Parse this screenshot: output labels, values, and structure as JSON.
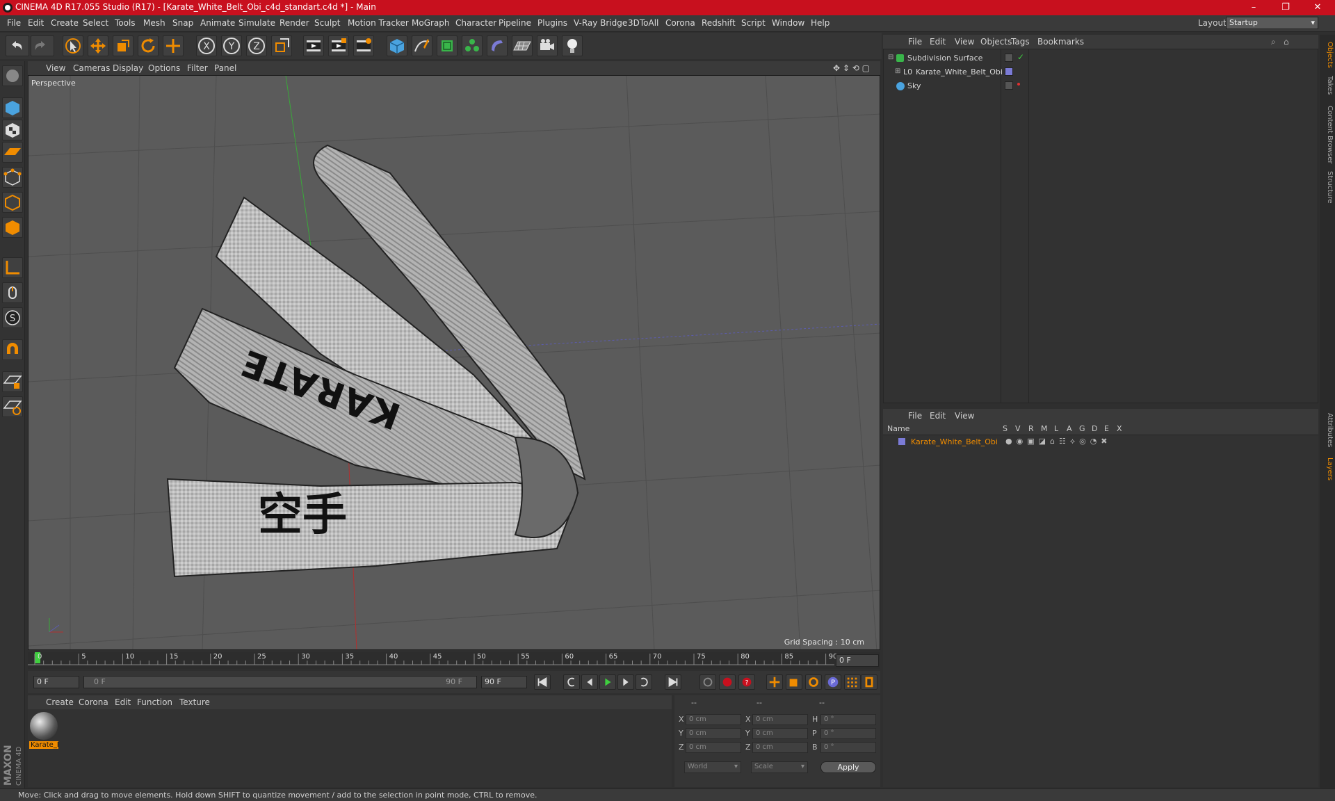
{
  "window": {
    "title": "CINEMA 4D R17.055 Studio (R17) - [Karate_White_Belt_Obi_c4d_standart.c4d *] - Main",
    "minimize": "–",
    "restore": "❐",
    "close": "✕"
  },
  "menu": [
    "File",
    "Edit",
    "Create",
    "Select",
    "Tools",
    "Mesh",
    "Snap",
    "Animate",
    "Simulate",
    "Render",
    "Sculpt",
    "Motion Tracker",
    "MoGraph",
    "Character",
    "Pipeline",
    "Plugins",
    "V-Ray Bridge",
    "3DToAll",
    "Corona",
    "Redshift",
    "Script",
    "Window",
    "Help"
  ],
  "layout": {
    "label": "Layout:",
    "value": "Startup"
  },
  "viewport": {
    "menu": [
      "View",
      "Cameras",
      "Display",
      "Options",
      "Filter",
      "Panel"
    ],
    "label": "Perspective",
    "grid_spacing": "Grid Spacing : 10 cm",
    "belt_text_1": "KARATE",
    "belt_text_2": "空手"
  },
  "timeline": {
    "ticks": [
      "0",
      "5",
      "10",
      "15",
      "20",
      "25",
      "30",
      "35",
      "40",
      "45",
      "50",
      "55",
      "60",
      "65",
      "70",
      "75",
      "80",
      "85",
      "90"
    ],
    "current_frame": "0 F",
    "start_field": "0 F",
    "range_start": "0 F",
    "range_end": "90 F",
    "end_field": "90 F"
  },
  "material_manager": {
    "menu": [
      "Create",
      "Corona",
      "Edit",
      "Function",
      "Texture"
    ],
    "materials": [
      {
        "label": "Karate_B"
      }
    ]
  },
  "coordinates": {
    "header": [
      "--",
      "--",
      "--"
    ],
    "rows": [
      {
        "a": "X",
        "av": "0 cm",
        "b": "X",
        "bv": "0 cm",
        "c": "H",
        "cv": "0 °"
      },
      {
        "a": "Y",
        "av": "0 cm",
        "b": "Y",
        "bv": "0 cm",
        "c": "P",
        "cv": "0 °"
      },
      {
        "a": "Z",
        "av": "0 cm",
        "b": "Z",
        "bv": "0 cm",
        "c": "B",
        "cv": "0 °"
      }
    ],
    "mode1": "World",
    "mode2": "Scale",
    "apply": "Apply"
  },
  "objects": {
    "menu": [
      "File",
      "Edit",
      "View",
      "Objects",
      "Tags",
      "Bookmarks"
    ],
    "items": [
      {
        "name": "Subdivision Surface"
      },
      {
        "name": "Karate_White_Belt_Obi"
      },
      {
        "name": "Sky"
      }
    ]
  },
  "layers": {
    "menu": [
      "File",
      "Edit",
      "View"
    ],
    "columns": [
      "Name",
      "S",
      "V",
      "R",
      "M",
      "L",
      "A",
      "G",
      "D",
      "E",
      "X"
    ],
    "items": [
      {
        "name": "Karate_White_Belt_Obi"
      }
    ]
  },
  "right_tabs": [
    "Objects",
    "Takes",
    "Content Browser",
    "Structure",
    "Attributes",
    "Layers"
  ],
  "brand": "MAXON CINEMA 4D",
  "status": "Move: Click and drag to move elements. Hold down SHIFT to quantize movement / add to the selection in point mode, CTRL to remove.",
  "colors": {
    "titlebar": "#c8101e",
    "accent_orange": "#f08c00",
    "layer_blue": "#7b7bd6"
  }
}
